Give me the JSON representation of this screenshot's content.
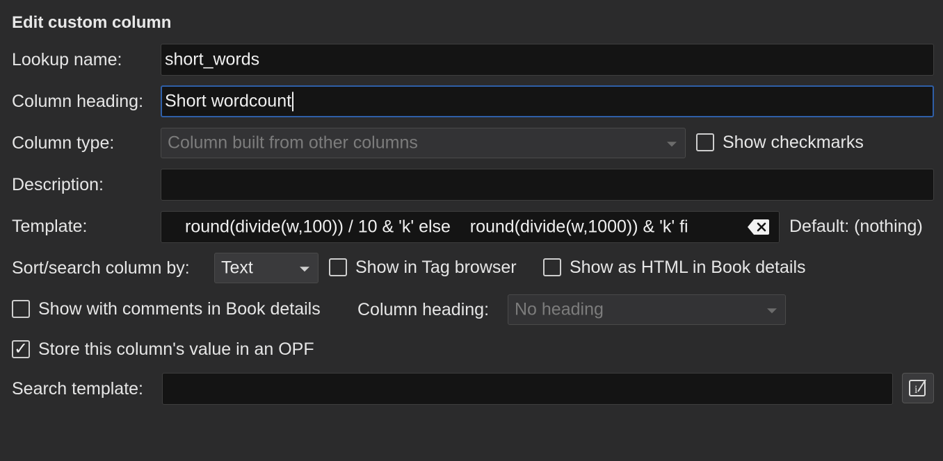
{
  "dialog": {
    "title": "Edit custom column"
  },
  "lookup": {
    "label": "Lookup name:",
    "value": "short_words"
  },
  "heading": {
    "label": "Column heading:",
    "value": "Short wordcount"
  },
  "column_type": {
    "label": "Column type:",
    "value": "Column built from other columns",
    "checkmarks_label": "Show checkmarks",
    "checkmarks_checked": false
  },
  "description": {
    "label": "Description:",
    "value": ""
  },
  "template": {
    "label": "Template:",
    "value": "round(divide(w,100)) / 10 & 'k' else    round(divide(w,1000)) & 'k' fi",
    "default_label": "Default: (nothing)",
    "clear_icon": "clear-text-icon"
  },
  "sort": {
    "label": "Sort/search column by:",
    "value": "Text",
    "tag_browser_label": "Show in Tag browser",
    "tag_browser_checked": false,
    "html_label": "Show as HTML in Book details",
    "html_checked": false
  },
  "comments": {
    "label": "Show with comments in Book details",
    "checked": false,
    "heading_label": "Column heading:",
    "heading_value": "No heading"
  },
  "opf": {
    "label": "Store this column's value in an OPF",
    "checked": true,
    "check_glyph": "✓"
  },
  "search_template": {
    "label": "Search template:",
    "value": "",
    "edit_icon": "template-edit-icon"
  },
  "colors": {
    "background": "#2b2b2c",
    "field_bg": "#141414",
    "focus_border": "#2f5fa8"
  }
}
